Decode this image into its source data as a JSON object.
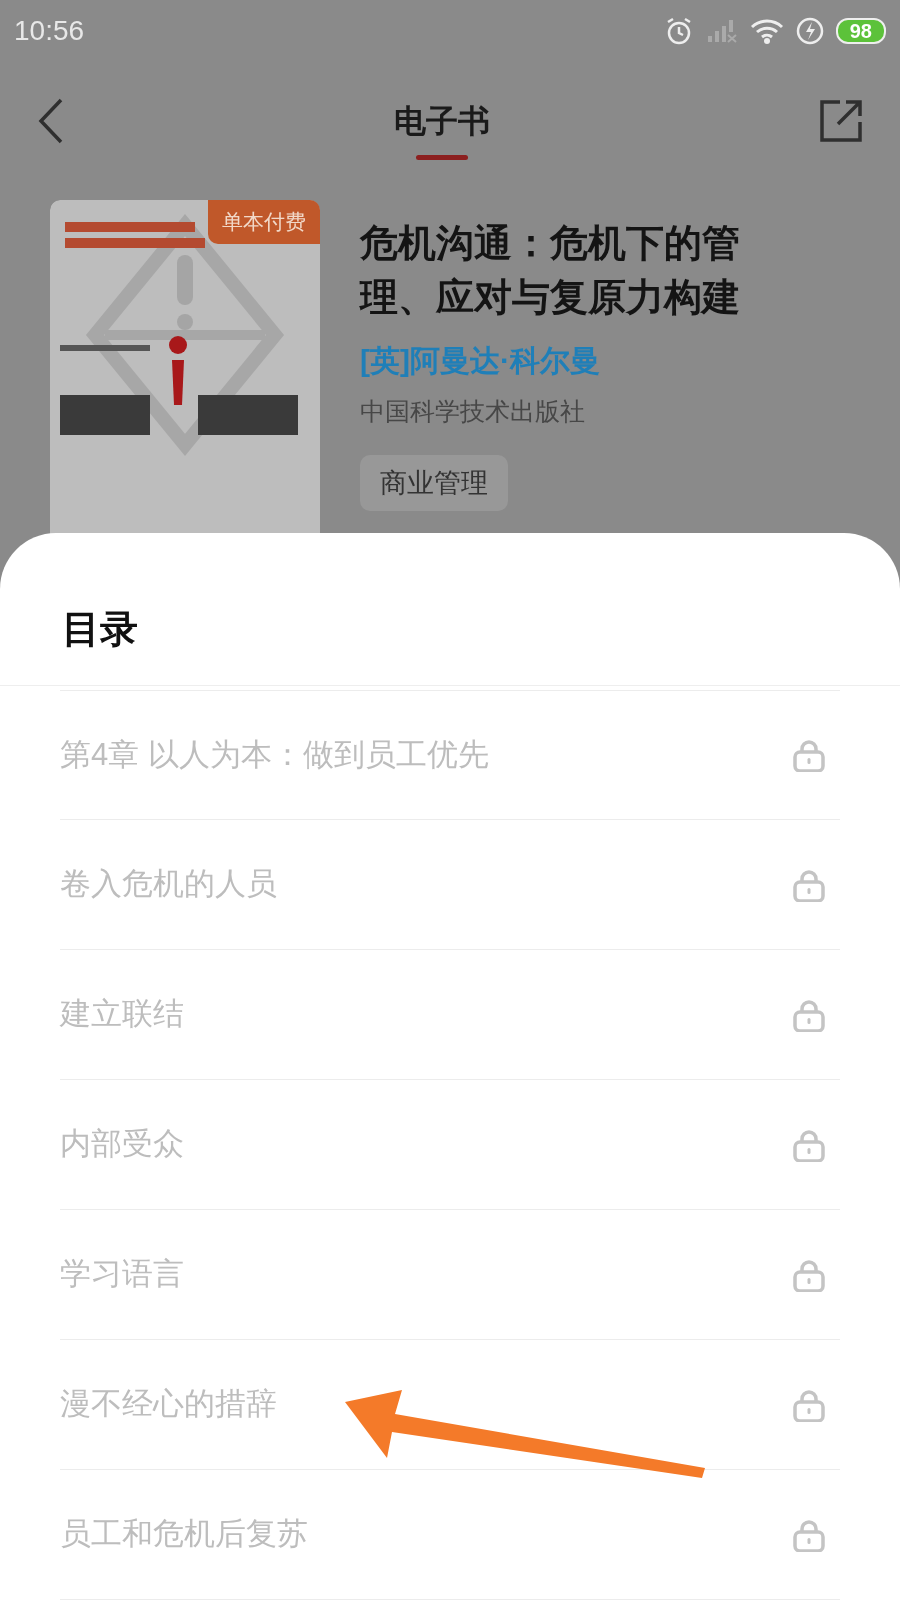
{
  "status_bar": {
    "time": "10:56",
    "battery": "98"
  },
  "header": {
    "title": "电子书"
  },
  "book": {
    "badge": "单本付费",
    "title": "危机沟通：危机下的管理、应对与复原力构建",
    "author": "[英]阿曼达·科尔曼",
    "publisher": "中国科学技术出版社",
    "tag": "商业管理"
  },
  "toc": {
    "title": "目录",
    "items": [
      {
        "label": "第4章 以人为本：做到员工优先",
        "locked": true
      },
      {
        "label": "卷入危机的人员",
        "locked": true
      },
      {
        "label": "建立联结",
        "locked": true
      },
      {
        "label": "内部受众",
        "locked": true
      },
      {
        "label": "学习语言",
        "locked": true
      },
      {
        "label": "漫不经心的措辞",
        "locked": true
      },
      {
        "label": "员工和危机后复苏",
        "locked": true
      }
    ]
  }
}
